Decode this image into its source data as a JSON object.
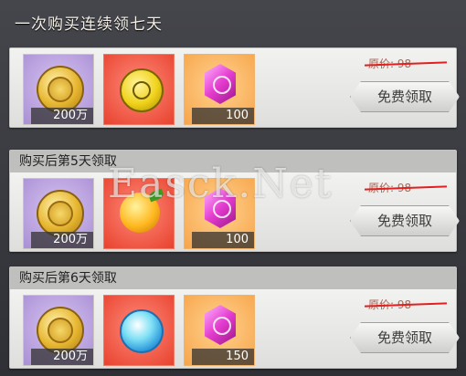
{
  "panel_title": "一次购买连续领七天",
  "watermark_text": "Easck.Net",
  "days": [
    {
      "header": "",
      "items": [
        {
          "icon": "gold-coin-icon",
          "qty": "200万"
        },
        {
          "icon": "yellow-orb-icon",
          "qty": ""
        },
        {
          "icon": "purple-gem-icon",
          "qty": "100"
        }
      ],
      "orig_price": "原价: 98",
      "claim_label": "免费领取"
    },
    {
      "header": "购买后第5天领取",
      "items": [
        {
          "icon": "gold-coin-icon",
          "qty": "200万"
        },
        {
          "icon": "golden-fruit-icon",
          "qty": ""
        },
        {
          "icon": "purple-gem-icon",
          "qty": "100"
        }
      ],
      "orig_price": "原价: 98",
      "claim_label": "免费领取"
    },
    {
      "header": "购买后第6天领取",
      "items": [
        {
          "icon": "gold-coin-icon",
          "qty": "200万"
        },
        {
          "icon": "blue-orb-icon",
          "qty": ""
        },
        {
          "icon": "purple-gem-icon",
          "qty": "150"
        }
      ],
      "orig_price": "原价: 98",
      "claim_label": "免费领取"
    }
  ]
}
